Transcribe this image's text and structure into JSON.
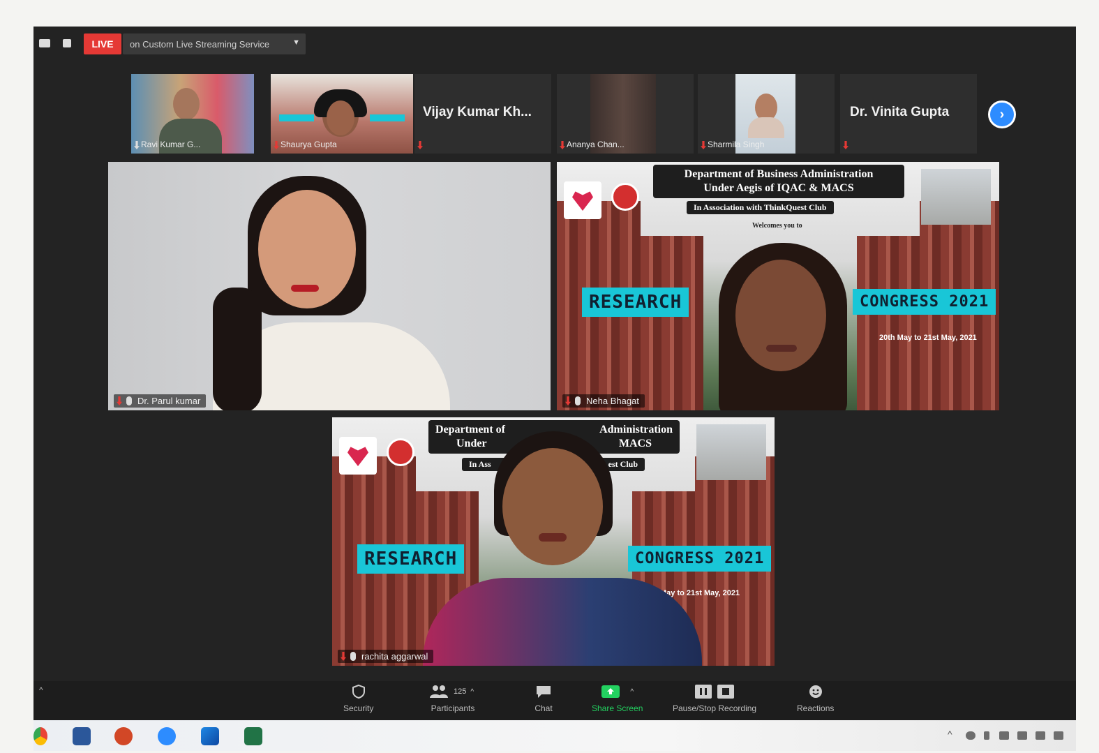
{
  "topbar": {
    "live_label": "LIVE",
    "stream_label": "on Custom Live Streaming Service"
  },
  "strip": [
    {
      "name": "Ravi Kumar G...",
      "type": "video"
    },
    {
      "name": "Shaurya Gupta",
      "type": "video"
    },
    {
      "name": "Vijay Kumar Kh...",
      "type": "name"
    },
    {
      "name": "Ananya Chan...",
      "type": "video"
    },
    {
      "name": "Sharmila Singh",
      "type": "video"
    },
    {
      "name": "Dr. Vinita Gupta",
      "type": "name"
    }
  ],
  "main": {
    "tile1_name": "Dr. Parul kumar",
    "tile2_name": "Neha Bhagat",
    "tile3_name": "rachita aggarwal"
  },
  "background": {
    "line1": "Department of Business Administration",
    "line2": "Under Aegis of IQAC & MACS",
    "assoc": "In Association with ThinkQuest Club",
    "welcome": "Welcomes you to",
    "left_tag": "RESEARCH",
    "right_tag": "CONGRESS 2021",
    "dates": "20th May to 21st May, 2021"
  },
  "tile3_banner": {
    "line1_left": "Department of",
    "line1_right": "Administration",
    "line2_left": "Under",
    "line2_right": "MACS",
    "assoc_left": "In Ass",
    "assoc_right": "est Club",
    "dates": "May to 21st May, 2021"
  },
  "toolbar": {
    "security": "Security",
    "participants": "Participants",
    "participants_count": "125",
    "chat": "Chat",
    "share": "Share Screen",
    "recording": "Pause/Stop Recording",
    "reactions": "Reactions"
  },
  "colors": {
    "live": "#e53935",
    "accent": "#2d8cff",
    "share_green": "#23d160",
    "cyan_tag": "#19c6d7"
  }
}
